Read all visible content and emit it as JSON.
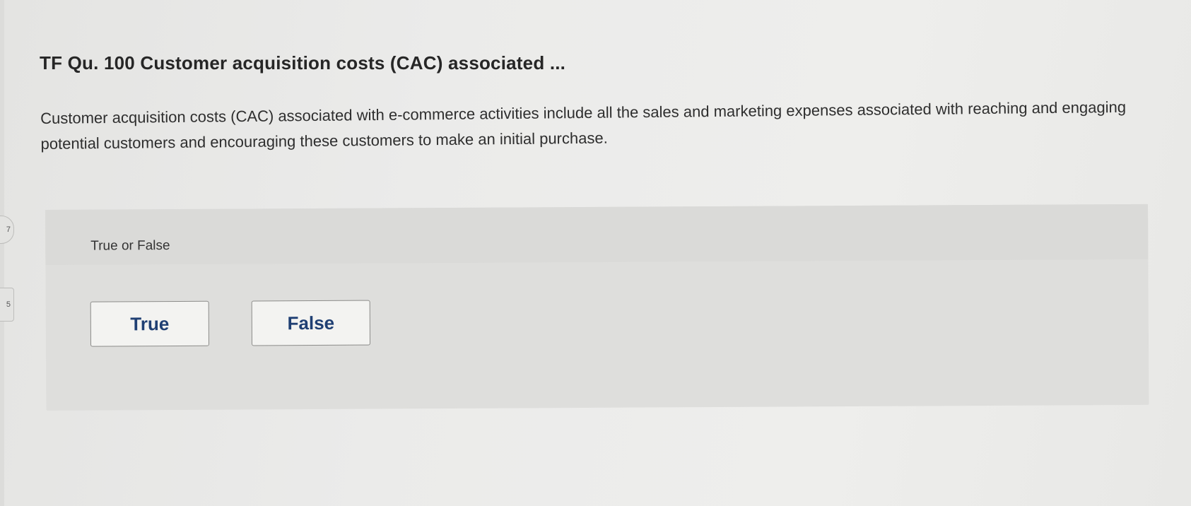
{
  "question": {
    "title": "TF Qu. 100 Customer acquisition costs (CAC) associated ...",
    "body": "Customer acquisition costs (CAC) associated with e-commerce activities include all the sales and marketing expenses associated with reaching and engaging potential customers and encouraging these customers to make an initial purchase."
  },
  "answer_panel": {
    "prompt": "True or False",
    "choices": [
      {
        "label": "True"
      },
      {
        "label": "False"
      }
    ]
  },
  "side_tabs": [
    {
      "label": "7"
    },
    {
      "label": "5"
    }
  ],
  "colors": {
    "button_text": "#1f3f73",
    "panel_background": "#dededc",
    "page_background": "#ebebea"
  }
}
